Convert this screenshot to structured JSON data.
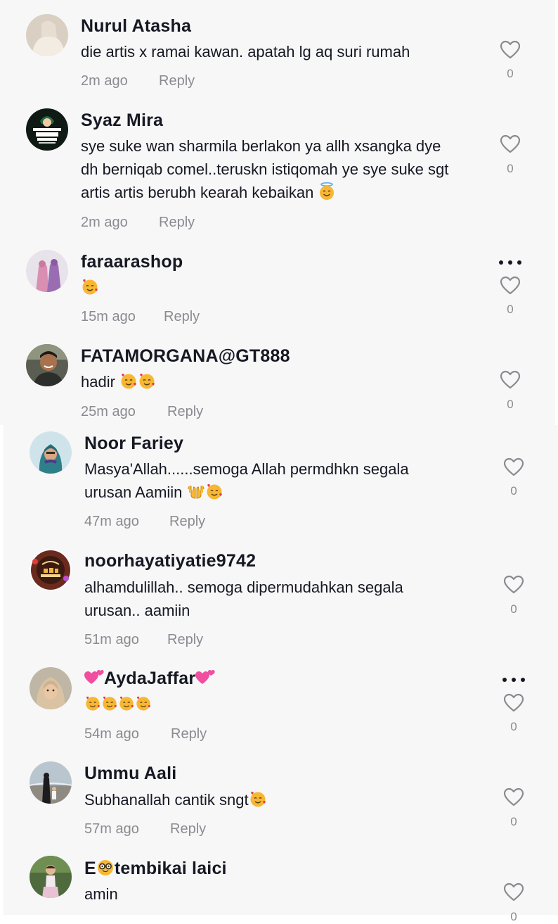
{
  "comments": [
    {
      "username": "Nurul Atasha",
      "lines": [
        "die artis x ramai kawan. apatah lg aq suri rumah"
      ],
      "time": "2m ago",
      "reply_label": "Reply",
      "likes": "0",
      "avatar": "avatar-woman-light",
      "has_more_menu": false
    },
    {
      "username": "Syaz Mira",
      "lines": [
        "sye suke wan sharmila berlakon ya allh xsangka dye",
        "dh berniqab comel..teruskn istiqomah ye sye suke sgt",
        "artis artis berubh kearah kebaikan"
      ],
      "trailing_emoji": "smiling-face-with-halo",
      "time": "2m ago",
      "reply_label": "Reply",
      "likes": "0",
      "avatar": "avatar-my-name-is-malaysia",
      "has_more_menu": false
    },
    {
      "username": "faraarashop",
      "lines": [
        ""
      ],
      "emojis": [
        "smiling-face-with-hearts"
      ],
      "time": "15m ago",
      "reply_label": "Reply",
      "likes": "0",
      "avatar": "avatar-two-women-pink",
      "has_more_menu": true
    },
    {
      "username": "FATAMORGANA@GT888",
      "lines": [
        "hadir"
      ],
      "emojis": [
        "smiling-face-with-hearts",
        "smiling-face-with-hearts"
      ],
      "time": "25m ago",
      "reply_label": "Reply",
      "likes": "0",
      "avatar": "avatar-man-smiling",
      "has_more_menu": false
    },
    {
      "username": "Noor Fariey",
      "lines": [
        "Masya'Allah......semoga Allah permdhkn segala",
        "urusan Aamiin"
      ],
      "emojis": [
        "palms-up-together",
        "smiling-face-with-hearts"
      ],
      "time": "47m ago",
      "reply_label": "Reply",
      "likes": "0",
      "avatar": "avatar-woman-hijab-teal",
      "has_more_menu": false
    },
    {
      "username": "noorhayatiyatie9742",
      "lines": [
        "alhamdulillah.. semoga dipermudahkan segala",
        "urusan.. aamiin"
      ],
      "time": "51m ago",
      "reply_label": "Reply",
      "likes": "0",
      "avatar": "avatar-alhamdulillah-frame",
      "has_more_menu": false
    },
    {
      "username": "AydaJaffar",
      "name_emoji": "two-hearts",
      "lines": [
        ""
      ],
      "emojis": [
        "smiling-face-with-hearts",
        "smiling-face-with-hearts",
        "smiling-face-with-hearts",
        "smiling-face-with-hearts"
      ],
      "time": "54m ago",
      "reply_label": "Reply",
      "likes": "0",
      "avatar": "avatar-woman-hijab-beige",
      "has_more_menu": true
    },
    {
      "username": "Ummu Aali",
      "lines": [
        "Subhanallah cantik sngt"
      ],
      "emojis": [
        "smiling-face-with-hearts"
      ],
      "time": "57m ago",
      "reply_label": "Reply",
      "likes": "0",
      "avatar": "avatar-beach-figures",
      "has_more_menu": false
    },
    {
      "username_parts": [
        "E",
        "tembikai laici"
      ],
      "name_emoji": "nerd-face",
      "lines": [
        "amin"
      ],
      "likes": "0",
      "avatar": "avatar-child-outdoor",
      "has_more_menu": false
    }
  ],
  "colors": {
    "background": "#ffffff",
    "card": "#f7f7f7",
    "text": "#161823",
    "muted": "#8a8b91",
    "heart_outline": "#8a8b91",
    "emoji_face": "#f7b733",
    "emoji_heart": "#e8384f"
  }
}
